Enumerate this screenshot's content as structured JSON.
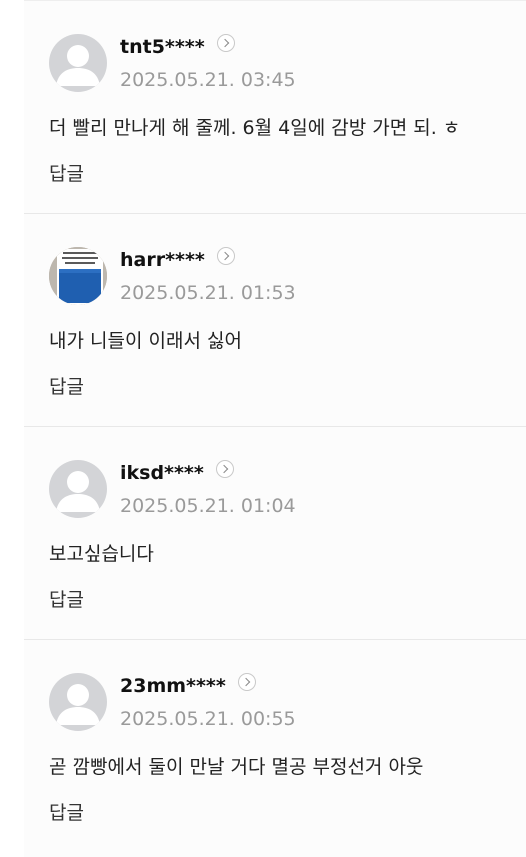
{
  "comments": [
    {
      "username": "tnt5****",
      "date": "2025.05.21. 03:45",
      "text": "더 빨리 만나게 해 줄께. 6월 4일에 감방 가면 되. ㅎ",
      "reply_label": "답글",
      "avatar": "default-avatar-icon"
    },
    {
      "username": "harr****",
      "date": "2025.05.21. 01:53",
      "text": "내가 니들이 이래서 싫어",
      "reply_label": "답글",
      "avatar": "book-cover-photo"
    },
    {
      "username": "iksd****",
      "date": "2025.05.21. 01:04",
      "text": "보고싶습니다",
      "reply_label": "답글",
      "avatar": "default-avatar-icon"
    },
    {
      "username": "23mm****",
      "date": "2025.05.21. 00:55",
      "text": "곧 깜빵에서 둘이 만날 거다 멸공 부정선거 아웃",
      "reply_label": "답글",
      "avatar": "default-avatar-icon"
    }
  ],
  "colors": {
    "username": "#111111",
    "date": "#9a9a9a",
    "avatar_bg": "#d3d4d7",
    "divider": "#e8e8e8"
  }
}
